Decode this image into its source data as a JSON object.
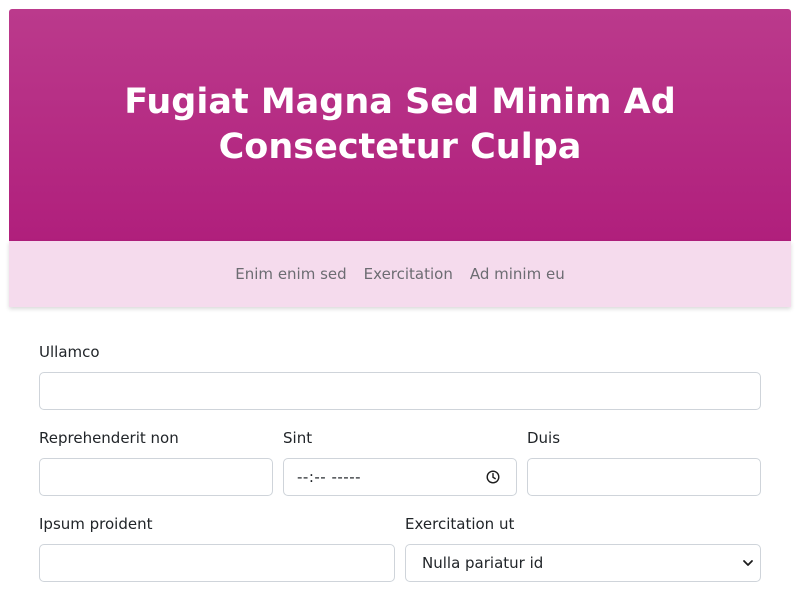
{
  "header": {
    "title": "Fugiat Magna Sed Minim Ad Consectetur Culpa"
  },
  "nav": {
    "items": [
      "Enim enim sed",
      "Exercitation",
      "Ad minim eu"
    ]
  },
  "form": {
    "ullamco": {
      "label": "Ullamco",
      "value": ""
    },
    "reprehenderit": {
      "label": "Reprehenderit non",
      "value": ""
    },
    "sint": {
      "label": "Sint",
      "display": "--:-- -----"
    },
    "duis": {
      "label": "Duis",
      "value": ""
    },
    "ipsum": {
      "label": "Ipsum proident",
      "value": ""
    },
    "exercitation": {
      "label": "Exercitation ut",
      "selected": "Nulla pariatur id"
    }
  },
  "colors": {
    "hero_top": "#bb3a8c",
    "hero_bottom": "#b01f7c",
    "subnav_bg": "#f5dbed",
    "nav_text": "#6c6c72"
  },
  "icons": {
    "time": "clock-icon",
    "select": "chevron-down-icon"
  }
}
